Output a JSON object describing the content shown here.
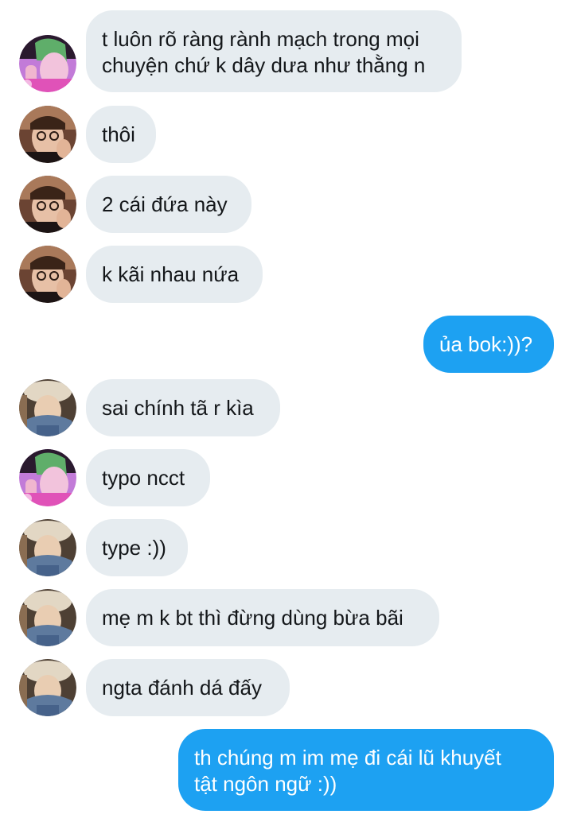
{
  "colors": {
    "incoming_bubble": "#e6ecf0",
    "outgoing_bubble": "#1da1f2",
    "incoming_text": "#14171a",
    "outgoing_text": "#ffffff"
  },
  "messages": [
    {
      "direction": "incoming",
      "avatar": "green-hair-avatar",
      "lines": [
        "t luôn rõ ràng rành mạch trong mọi",
        "chuyện chứ k dây dưa như thằng n"
      ]
    },
    {
      "direction": "incoming",
      "avatar": "glasses-avatar",
      "lines": [
        "thôi"
      ]
    },
    {
      "direction": "incoming",
      "avatar": "glasses-avatar",
      "lines": [
        "2 cái đứa này"
      ]
    },
    {
      "direction": "incoming",
      "avatar": "glasses-avatar",
      "lines": [
        "k kãi nhau nứa"
      ]
    },
    {
      "direction": "outgoing",
      "lines": [
        "ủa bok:))?"
      ]
    },
    {
      "direction": "incoming",
      "avatar": "beret-avatar",
      "lines": [
        "sai chính tã r kìa"
      ]
    },
    {
      "direction": "incoming",
      "avatar": "green-hair-avatar",
      "lines": [
        "typo ncct"
      ]
    },
    {
      "direction": "incoming",
      "avatar": "beret-avatar",
      "lines": [
        "type :))"
      ]
    },
    {
      "direction": "incoming",
      "avatar": "beret-avatar",
      "lines": [
        "mẹ m k bt thì đừng dùng bừa bãi"
      ]
    },
    {
      "direction": "incoming",
      "avatar": "beret-avatar",
      "lines": [
        "ngta đánh dá đấy"
      ]
    },
    {
      "direction": "outgoing",
      "lines": [
        "th chúng m im mẹ đi cái lũ khuyết",
        "tật ngôn ngữ :))"
      ]
    }
  ]
}
